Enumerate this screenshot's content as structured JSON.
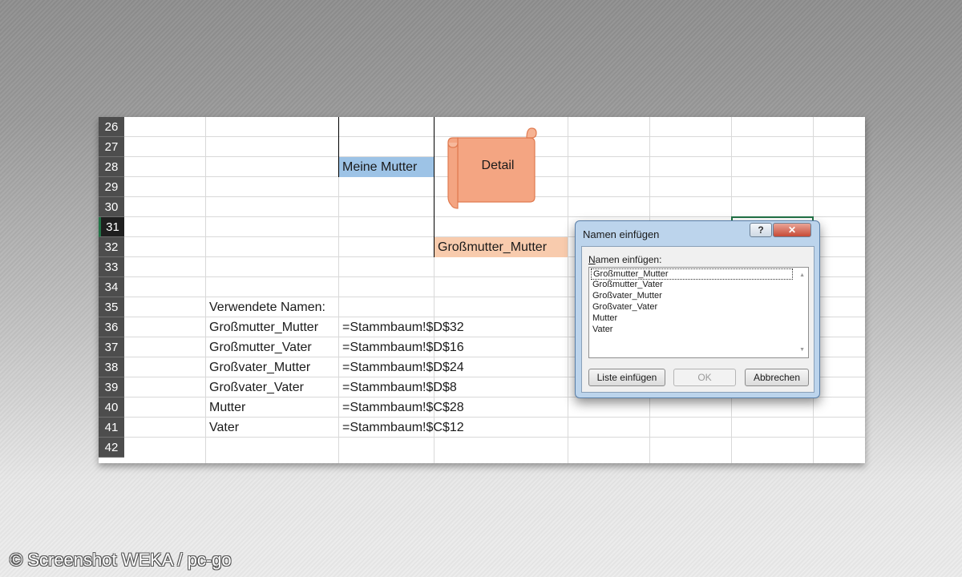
{
  "sheet": {
    "row_numbers": [
      "26",
      "27",
      "28",
      "29",
      "30",
      "31",
      "32",
      "33",
      "34",
      "35",
      "36",
      "37",
      "38",
      "39",
      "40",
      "41",
      "42"
    ],
    "active_row": "31",
    "cells": {
      "meine_mutter": "Meine Mutter",
      "detail_shape": "Detail",
      "grossmutter_mutter": "Großmutter_Mutter",
      "verwendete_namen": "Verwendete Namen:"
    },
    "names_table": [
      {
        "name": "Großmutter_Mutter",
        "ref": "=Stammbaum!$D$32"
      },
      {
        "name": "Großmutter_Vater",
        "ref": "=Stammbaum!$D$16"
      },
      {
        "name": "Großvater_Mutter",
        "ref": "=Stammbaum!$D$24"
      },
      {
        "name": "Großvater_Vater",
        "ref": "=Stammbaum!$D$8"
      },
      {
        "name": "Mutter",
        "ref": "=Stammbaum!$C$28"
      },
      {
        "name": "Vater",
        "ref": "=Stammbaum!$C$12"
      }
    ],
    "colors": {
      "meine_mutter_fill": "#9dc3e6",
      "grossmutter_fill": "#f8cbad",
      "shape_fill": "#f4a582",
      "row_header_bg": "#4d4d4d"
    }
  },
  "dialog": {
    "title": "Namen einfügen",
    "help_label": "?",
    "close_label": "✕",
    "list_label": "Namen einfügen:",
    "names": [
      "Großmutter_Mutter",
      "Großmutter_Vater",
      "Großvater_Mutter",
      "Großvater_Vater",
      "Mutter",
      "Vater"
    ],
    "selected_index": 0,
    "buttons": {
      "paste_list": "Liste einfügen",
      "ok": "OK",
      "cancel": "Abbrechen"
    }
  },
  "watermark": "© Screenshot WEKA / pc-go"
}
